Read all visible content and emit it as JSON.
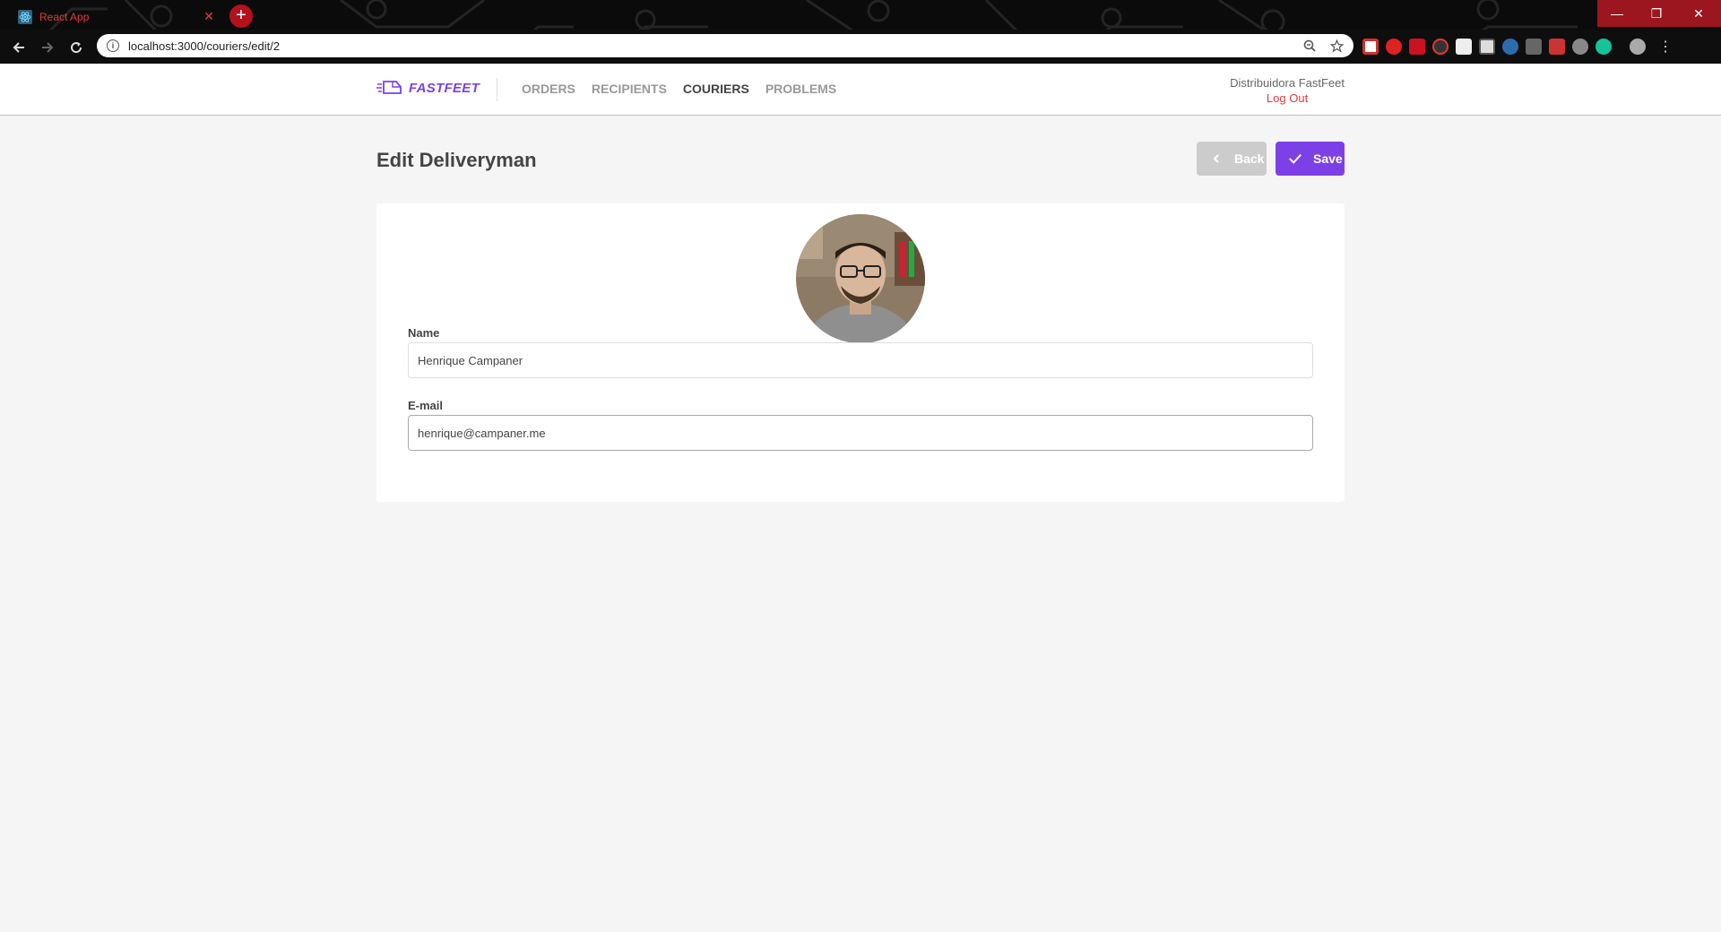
{
  "browser": {
    "tab_title": "React App",
    "url": "localhost:3000/couriers/edit/2",
    "accent_color": "#b3121c"
  },
  "app": {
    "logo_text": "FASTFEET",
    "brand_color": "#7d40e7",
    "nav": [
      {
        "label": "ORDERS",
        "active": false
      },
      {
        "label": "RECIPIENTS",
        "active": false
      },
      {
        "label": "COURIERS",
        "active": true
      },
      {
        "label": "PROBLEMS",
        "active": false
      }
    ],
    "user": {
      "name": "Distribuidora FastFeet",
      "logout_label": "Log Out"
    }
  },
  "page": {
    "title": "Edit Deliveryman",
    "back_label": "Back",
    "save_label": "Save"
  },
  "form": {
    "name_label": "Name",
    "name_value": "Henrique Campaner",
    "email_label": "E-mail",
    "email_value": "henrique@campaner.me"
  },
  "icons": {
    "tab_favicon": "react-icon",
    "back": "chevron-left-icon",
    "save": "check-icon",
    "avatar": "avatar-photo"
  }
}
